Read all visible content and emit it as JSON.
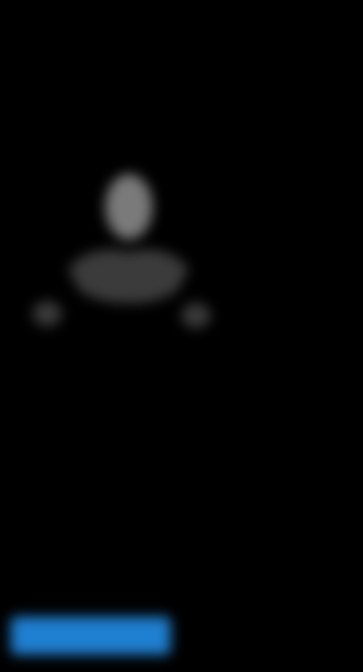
{
  "header": {
    "headline": "",
    "subline": ""
  },
  "figure": {
    "icon": "person-silhouette-icon"
  },
  "section": {
    "title": ""
  },
  "body": {
    "paragraph": ""
  },
  "cta": {
    "label": ""
  },
  "colors": {
    "background": "#000000",
    "accent": "#1f7fd0",
    "text": "#bdbdbd"
  }
}
